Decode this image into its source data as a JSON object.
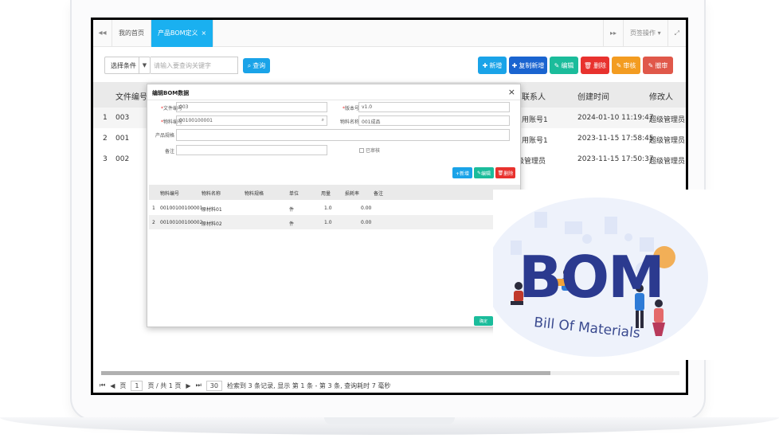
{
  "tabbar": {
    "home_tab": "我的首页",
    "active_tab": "产品BOM定义",
    "close_glyph": "×",
    "left_nav": "◂◂",
    "right_nav": "▸▸",
    "tab_ops": "页签操作 ▾",
    "fullscreen": "⤢"
  },
  "toolbar": {
    "condition_select": "选择条件",
    "search_placeholder": "请输入要查询关键字",
    "query_label": "查询",
    "buttons": [
      {
        "label": "新增",
        "color": "#1aa3e8"
      },
      {
        "label": "复制新增",
        "color": "#1a64d0"
      },
      {
        "label": "编辑",
        "color": "#1bbc9b"
      },
      {
        "label": "删除",
        "color": "#e8322e"
      },
      {
        "label": "审核",
        "color": "#f39c21"
      },
      {
        "label": "撤审",
        "color": "#e0584a"
      }
    ]
  },
  "grid": {
    "columns": [
      "文件编号",
      "联系人",
      "创建时间",
      "修改人"
    ],
    "rows": [
      {
        "index": "1",
        "doc_no": "003",
        "contact": "用账号1",
        "created": "2024-01-10 11:19:47",
        "modifier": "超级管理员"
      },
      {
        "index": "2",
        "doc_no": "001",
        "contact": "用账号1",
        "created": "2023-11-15 17:58:45",
        "modifier": "超级管理员"
      },
      {
        "index": "3",
        "doc_no": "002",
        "contact": "级管理员",
        "created": "2023-11-15 17:50:37",
        "modifier": "超级管理员"
      }
    ]
  },
  "pager": {
    "first": "⏮",
    "prev": "◀",
    "page_label": "页",
    "page_value": "1",
    "total_label": "页 / 共 1 页",
    "next": "▶",
    "last": "⏭",
    "page_size": "30",
    "summary": "检索到 3 条记录, 显示 第 1 条 - 第 3 条, 查询耗时 7 毫秒"
  },
  "modal": {
    "title": "编辑BOM数据",
    "close": "×",
    "fields": {
      "doc_no_label": "文件编号",
      "doc_no_value": "003",
      "version_label": "版本号",
      "version_value": "v1.0",
      "material_code_label": "物料编号",
      "material_code_value": "00100100001",
      "material_name_label": "物料名称",
      "material_name_value": "001成品",
      "spec_label": "产品规格",
      "spec_value": "",
      "remark_label": "备注",
      "remark_value": "",
      "audited_label": "已审核"
    },
    "action_buttons": [
      {
        "label": "+新增",
        "color": "#1aa3e8"
      },
      {
        "label": "编辑",
        "color": "#1bbc9b"
      },
      {
        "label": "删除",
        "color": "#e8322e"
      }
    ],
    "sub_columns": [
      "物料编号",
      "物料名称",
      "物料规格",
      "单位",
      "用量",
      "损耗率",
      "备注"
    ],
    "sub_rows": [
      {
        "index": "1",
        "code": "00100100100001",
        "name": "原材料01",
        "spec": "",
        "unit": "件",
        "qty": "1.0",
        "loss": "0.00",
        "remark": ""
      },
      {
        "index": "2",
        "code": "00100100100002",
        "name": "原材料02",
        "spec": "",
        "unit": "件",
        "qty": "1.0",
        "loss": "0.00",
        "remark": ""
      }
    ],
    "confirm_label": "确定"
  },
  "promo": {
    "headline": "BOM",
    "subline": "Bill Of Materials",
    "colors": {
      "primary": "#2b3a8f",
      "accent": "#f2a33a",
      "light": "#dfe6f7"
    }
  }
}
